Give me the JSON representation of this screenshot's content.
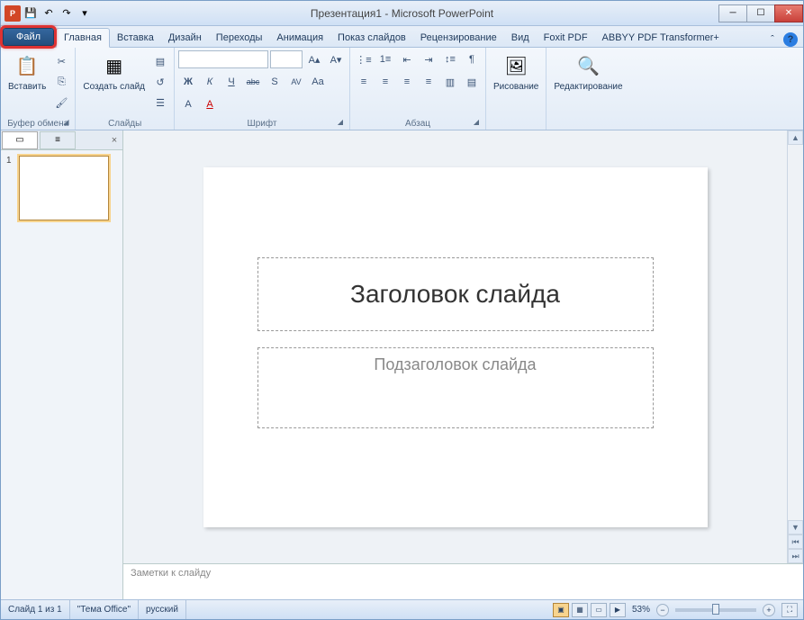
{
  "title": "Презентация1 - Microsoft PowerPoint",
  "qat": {
    "save": "💾",
    "undo": "↶",
    "redo": "↷",
    "more": "▾"
  },
  "win": {
    "min": "─",
    "max": "☐",
    "close": "✕"
  },
  "tabs": {
    "file": "Файл",
    "items": [
      "Главная",
      "Вставка",
      "Дизайн",
      "Переходы",
      "Анимация",
      "Показ слайдов",
      "Рецензирование",
      "Вид",
      "Foxit PDF",
      "ABBYY PDF Transformer+"
    ],
    "active_index": 0
  },
  "ribbon": {
    "clipboard": {
      "label": "Буфер обмена",
      "paste": "Вставить",
      "paste_icon": "📋"
    },
    "slides": {
      "label": "Слайды",
      "new_slide": "Создать\nслайд",
      "icon": "▦"
    },
    "font": {
      "label": "Шрифт",
      "family": "",
      "size": "",
      "grow": "A▴",
      "shrink": "A▾",
      "bold": "Ж",
      "italic": "К",
      "underline": "Ч",
      "strike": "abc",
      "shadow": "S",
      "spacing": "AV",
      "case": "Aa",
      "clear": "A",
      "color": "A"
    },
    "paragraph": {
      "label": "Абзац",
      "bullets": "⋮≡",
      "numbers": "1≡",
      "indent_dec": "⇤",
      "indent_inc": "⇥",
      "linespace": "↕≡",
      "direction": "¶",
      "align_l": "≡",
      "align_c": "≡",
      "align_r": "≡",
      "align_j": "≡",
      "columns": "▥",
      "convert": "▤"
    },
    "drawing": {
      "label": "Рисование",
      "btn": "Рисование",
      "icon": "🖼"
    },
    "editing": {
      "label": "Редактирование",
      "btn": "Редактирование",
      "icon": "🔍"
    }
  },
  "panel": {
    "close": "×",
    "thumb_num": "1"
  },
  "slide": {
    "title": "Заголовок слайда",
    "subtitle": "Подзаголовок слайда"
  },
  "notes": {
    "placeholder": "Заметки к слайду"
  },
  "status": {
    "slide_info": "Слайд 1 из 1",
    "theme": "\"Тема Office\"",
    "lang": "русский",
    "zoom": "53%",
    "views": {
      "normal": "▣",
      "sorter": "▦",
      "reading": "▭",
      "show": "▶"
    },
    "minus": "−",
    "plus": "+",
    "fit": "⛶"
  },
  "scroll": {
    "up": "▲",
    "down": "▼",
    "prev": "⏮",
    "next": "⏭"
  }
}
